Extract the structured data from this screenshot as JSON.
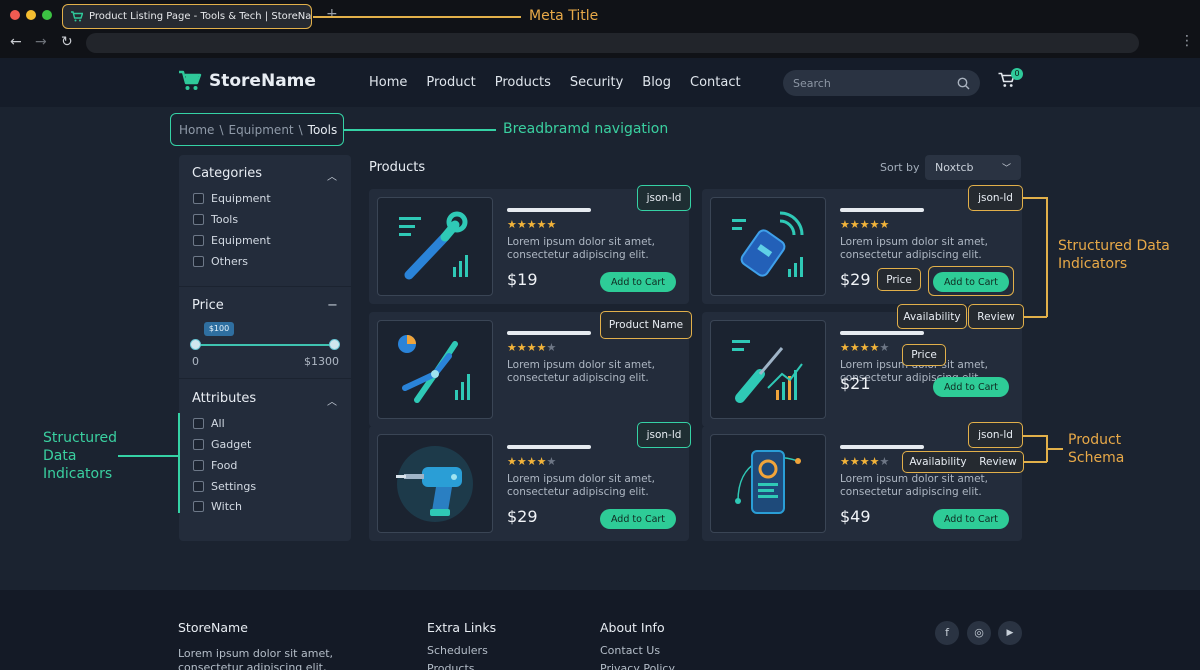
{
  "browser": {
    "tab_title": "Product Listing Page - Tools & Tech | StoreName",
    "new_tab": "+",
    "back": "←",
    "forward": "→",
    "reload": "↻",
    "menu": "⋮"
  },
  "header": {
    "logo": "StoreName",
    "nav": [
      "Home",
      "Product",
      "Products",
      "Security",
      "Blog",
      "Contact"
    ],
    "search_placeholder": "Search",
    "cart_count": "0"
  },
  "breadcrumb": {
    "items": [
      "Home",
      "Equipment",
      "Tools"
    ],
    "separator": "\\"
  },
  "sidebar": {
    "categories": {
      "title": "Categories",
      "items": [
        "Equipment",
        "Tools",
        "Equipment",
        "Others"
      ]
    },
    "price": {
      "title": "Price",
      "tooltip": "$100",
      "min": "0",
      "max": "$1300",
      "value_fraction": 0.05
    },
    "attributes": {
      "title": "Attributes",
      "items": [
        "All",
        "Gadget",
        "Food",
        "Settings",
        "Witch"
      ]
    }
  },
  "products": {
    "title": "Products",
    "sort_label": "Sort by",
    "sort_value": "Noxtcb",
    "add_label": "Add to Cart",
    "description": "Lorem ipsum dolor sit amet, consectetur adipiscing elit.",
    "items": [
      {
        "price": "$19",
        "rating": 4.5,
        "icon": "wrench-chart-icon"
      },
      {
        "price": "$29",
        "rating": 4.5,
        "icon": "smart-tag-icon"
      },
      {
        "price": "",
        "rating": 4,
        "icon": "pliers-chart-icon"
      },
      {
        "price": "$21",
        "rating": 4,
        "icon": "screwdriver-chart-icon"
      },
      {
        "price": "$29",
        "rating": 4,
        "icon": "drill-icon"
      },
      {
        "price": "$49",
        "rating": 4,
        "icon": "phone-icon"
      }
    ]
  },
  "annotations": {
    "meta_title": "Meta Title",
    "breadcrumb_nav": "Breadbramd navigation",
    "structured_data_right": "Structured Data Indicators",
    "structured_data_left": "Structured Data Indicators",
    "product_schema": "Product Schema",
    "tags": {
      "json_ld": "json-ld",
      "price": "Price",
      "product_name": "Product Name",
      "availability": "Availability",
      "review": "Review"
    }
  },
  "footer": {
    "brand": "StoreName",
    "brand_text": "Lorem ipsum dolor sit amet, consectetur adipiscing elit, sed",
    "extra_title": "Extra Links",
    "extra_links": [
      "Schedulers",
      "Products"
    ],
    "about_title": "About Info",
    "about_links": [
      "Contact Us",
      "Privacy Policy"
    ],
    "social": [
      "f",
      "◎",
      "▶"
    ]
  },
  "colors": {
    "accent_green": "#2ecc97",
    "annotation_orange": "#e2b04a",
    "annotation_green": "#35d2a5",
    "star": "#f3b43a"
  }
}
